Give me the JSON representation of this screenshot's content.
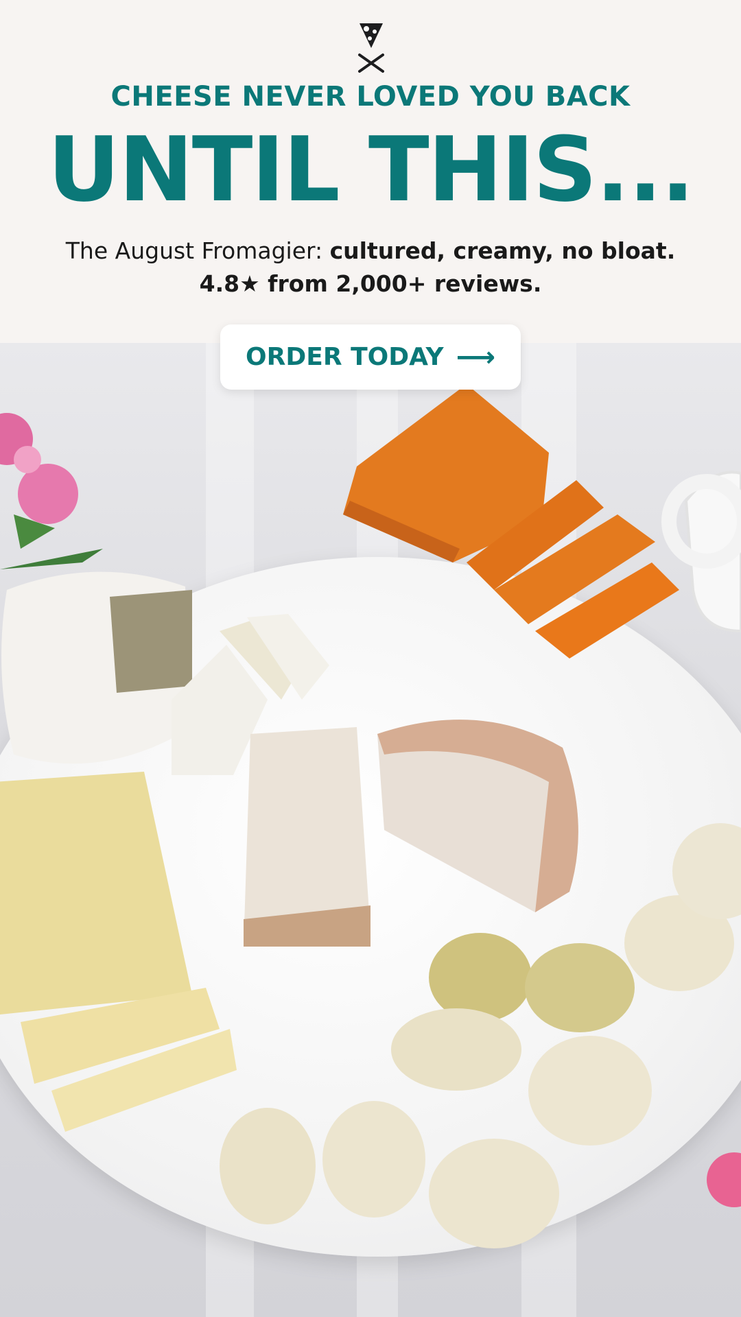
{
  "brand": {
    "logo_icon": "pizza-slice-crossed-knife-fork-icon"
  },
  "hero": {
    "tagline": "CHEESE NEVER LOVED YOU BACK",
    "headline": "UNTIL THIS...",
    "description_intro": "The August Fromagier: ",
    "description_bold": "cultured, creamy, no bloat.",
    "rating_line": "4.8★ from 2,000+ reviews."
  },
  "cta": {
    "label": "ORDER TODAY",
    "arrow": "⟶"
  },
  "colors": {
    "brand_teal": "#0b7878",
    "background": "#f7f4f2"
  }
}
